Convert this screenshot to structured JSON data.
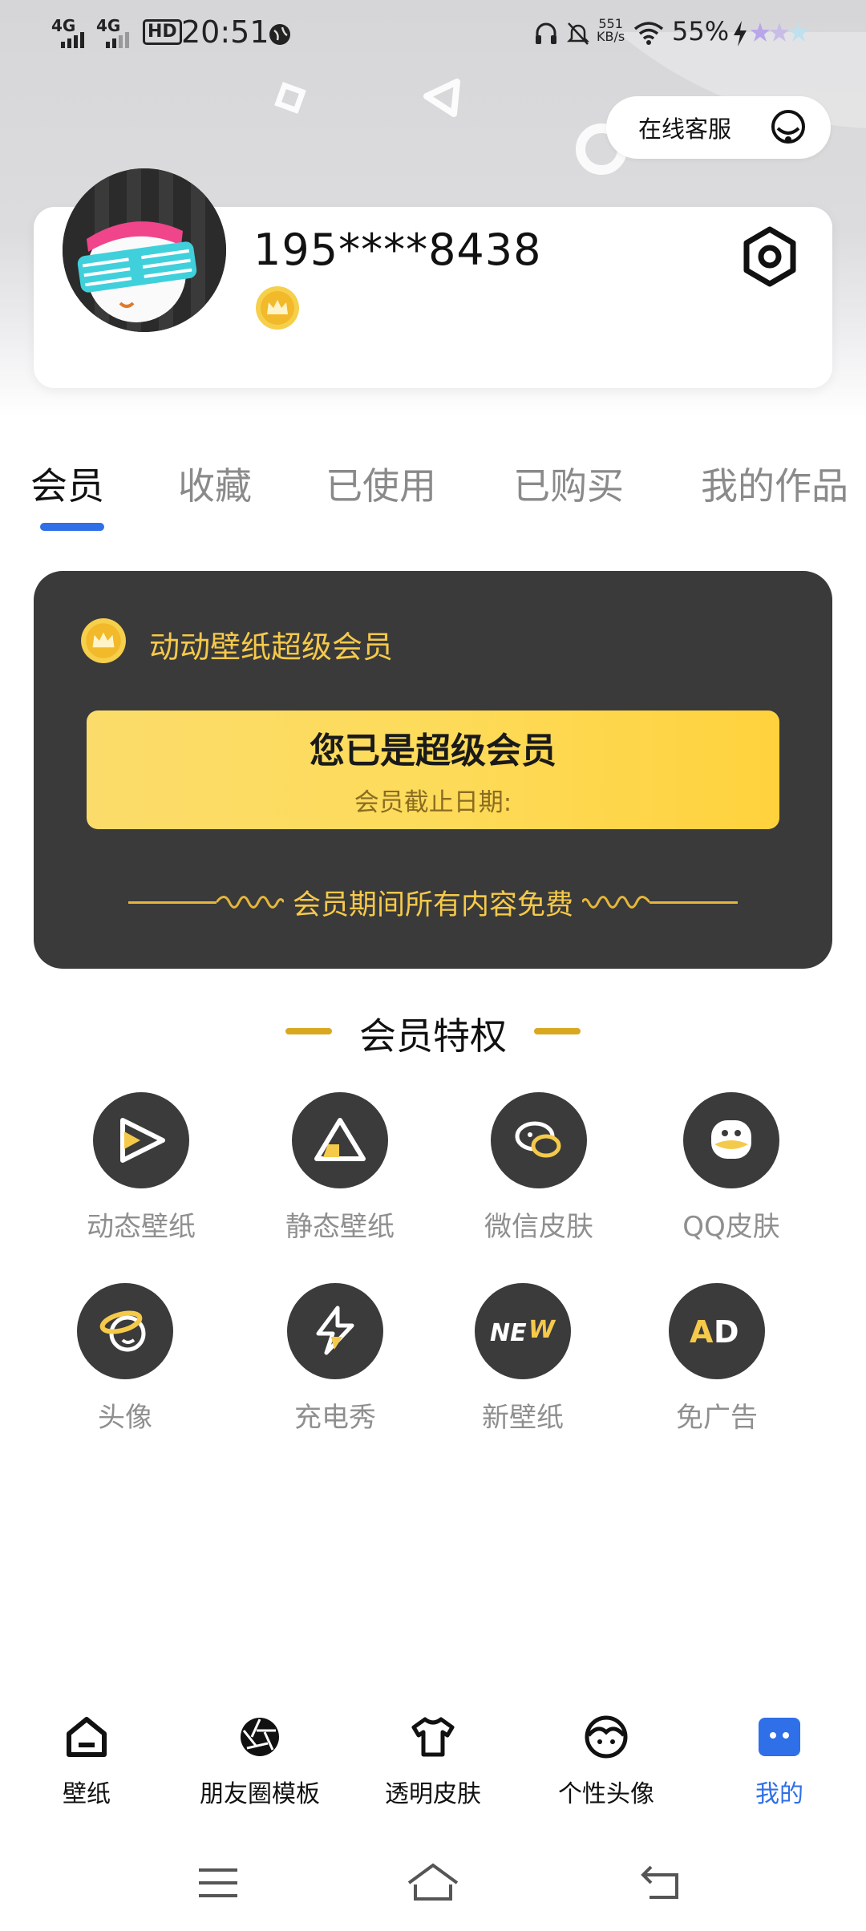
{
  "status_bar": {
    "network_1": "4G",
    "network_2": "4G",
    "hd": "HD",
    "time": "20:51",
    "speed_value": "551",
    "speed_unit": "KB/s",
    "battery": "55%"
  },
  "header": {
    "service_label": "在线客服",
    "phone": "195****8438"
  },
  "tabs": [
    {
      "label": "会员",
      "active": true
    },
    {
      "label": "收藏",
      "active": false
    },
    {
      "label": "已使用",
      "active": false
    },
    {
      "label": "已购买",
      "active": false
    },
    {
      "label": "我的作品",
      "active": false
    }
  ],
  "vip": {
    "title": "动动壁纸超级会员",
    "status": "您已是超级会员",
    "expire_label": "会员截止日期:",
    "free_text": "会员期间所有内容免费"
  },
  "privileges": {
    "title": "会员特权",
    "items": [
      {
        "label": "动态壁纸",
        "icon": "play-icon"
      },
      {
        "label": "静态壁纸",
        "icon": "triangle-icon"
      },
      {
        "label": "微信皮肤",
        "icon": "wechat-icon"
      },
      {
        "label": "QQ皮肤",
        "icon": "qq-penguin-icon"
      },
      {
        "label": "头像",
        "icon": "planet-face-icon"
      },
      {
        "label": "充电秀",
        "icon": "lightning-icon"
      },
      {
        "label": "新壁纸",
        "icon": "new-badge-icon"
      },
      {
        "label": "免广告",
        "icon": "ad-icon"
      }
    ]
  },
  "bottom_nav": [
    {
      "label": "壁纸",
      "icon": "home-icon",
      "active": false
    },
    {
      "label": "朋友圈模板",
      "icon": "aperture-icon",
      "active": false
    },
    {
      "label": "透明皮肤",
      "icon": "tshirt-icon",
      "active": false
    },
    {
      "label": "个性头像",
      "icon": "face-icon",
      "active": false
    },
    {
      "label": "我的",
      "icon": "profile-icon",
      "active": true
    }
  ],
  "colors": {
    "accent_blue": "#2f6fe8",
    "gold": "#f5c94a",
    "card_dark": "#3a3a3a"
  }
}
